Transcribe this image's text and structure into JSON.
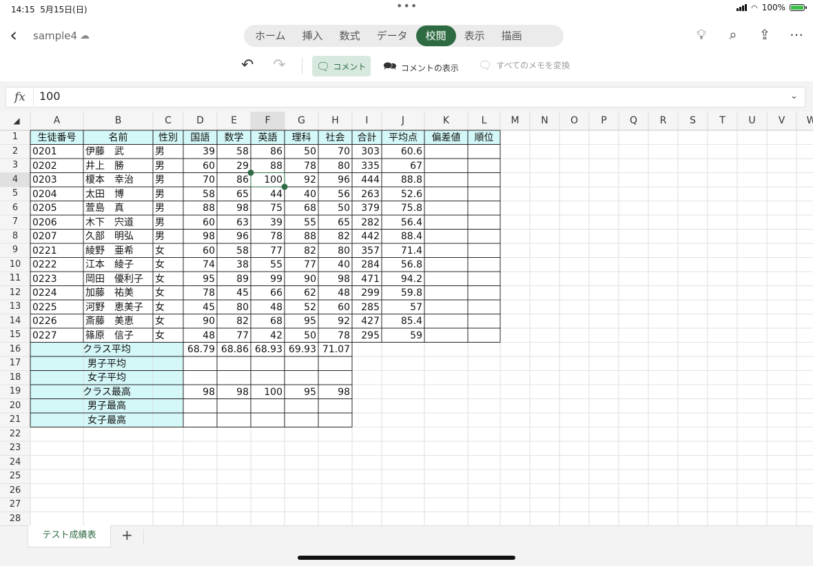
{
  "status": {
    "time": "14:15",
    "date": "5月15日(日)",
    "battery": "100%"
  },
  "app": {
    "filename": "sample4"
  },
  "tabs": [
    {
      "label": "ホーム",
      "active": false
    },
    {
      "label": "挿入",
      "active": false
    },
    {
      "label": "数式",
      "active": false
    },
    {
      "label": "データ",
      "active": false
    },
    {
      "label": "校閲",
      "active": true
    },
    {
      "label": "表示",
      "active": false
    },
    {
      "label": "描画",
      "active": false
    }
  ],
  "ribbon": {
    "comment": "コメント",
    "show_comments": "コメントの表示",
    "convert_notes": "すべてのメモを変換"
  },
  "formula": {
    "fx": "fx",
    "value": "100"
  },
  "columns": [
    "A",
    "B",
    "C",
    "D",
    "E",
    "F",
    "G",
    "H",
    "I",
    "J",
    "K",
    "L",
    "M",
    "N",
    "O",
    "P",
    "Q",
    "R",
    "S",
    "T",
    "U",
    "V",
    "W"
  ],
  "rows": [
    "1",
    "2",
    "3",
    "4",
    "5",
    "6",
    "7",
    "8",
    "9",
    "10",
    "11",
    "12",
    "13",
    "14",
    "15",
    "16",
    "17",
    "18",
    "19",
    "20",
    "21",
    "22",
    "23",
    "24",
    "25",
    "26",
    "27",
    "28"
  ],
  "selected": {
    "col": "F",
    "row": "4"
  },
  "header_row": [
    "生徒番号",
    "名前",
    "性別",
    "国語",
    "数学",
    "英語",
    "理科",
    "社会",
    "合計",
    "平均点",
    "偏差値",
    "順位"
  ],
  "students": [
    [
      "0201",
      "伊藤　武",
      "男",
      "39",
      "58",
      "86",
      "50",
      "70",
      "303",
      "60.6"
    ],
    [
      "0202",
      "井上　勝",
      "男",
      "60",
      "29",
      "88",
      "78",
      "80",
      "335",
      "67"
    ],
    [
      "0203",
      "榎本　幸治",
      "男",
      "70",
      "86",
      "100",
      "92",
      "96",
      "444",
      "88.8"
    ],
    [
      "0204",
      "太田　博",
      "男",
      "58",
      "65",
      "44",
      "40",
      "56",
      "263",
      "52.6"
    ],
    [
      "0205",
      "萱島　真",
      "男",
      "88",
      "98",
      "75",
      "68",
      "50",
      "379",
      "75.8"
    ],
    [
      "0206",
      "木下　宍道",
      "男",
      "60",
      "63",
      "39",
      "55",
      "65",
      "282",
      "56.4"
    ],
    [
      "0207",
      "久部　明弘",
      "男",
      "98",
      "96",
      "78",
      "88",
      "82",
      "442",
      "88.4"
    ],
    [
      "0221",
      "綾野　亜希",
      "女",
      "60",
      "58",
      "77",
      "82",
      "80",
      "357",
      "71.4"
    ],
    [
      "0222",
      "江本　綾子",
      "女",
      "74",
      "38",
      "55",
      "77",
      "40",
      "284",
      "56.8"
    ],
    [
      "0223",
      "岡田　優利子",
      "女",
      "95",
      "89",
      "99",
      "90",
      "98",
      "471",
      "94.2"
    ],
    [
      "0224",
      "加藤　祐美",
      "女",
      "78",
      "45",
      "66",
      "62",
      "48",
      "299",
      "59.8"
    ],
    [
      "0225",
      "河野　恵美子",
      "女",
      "45",
      "80",
      "48",
      "52",
      "60",
      "285",
      "57"
    ],
    [
      "0226",
      "斎藤　美恵",
      "女",
      "90",
      "82",
      "68",
      "95",
      "92",
      "427",
      "85.4"
    ],
    [
      "0227",
      "篠原　信子",
      "女",
      "48",
      "77",
      "42",
      "50",
      "78",
      "295",
      "59"
    ]
  ],
  "summary": [
    {
      "label": "クラス平均",
      "values": [
        "68.79",
        "68.86",
        "68.93",
        "69.93",
        "71.07"
      ]
    },
    {
      "label": "男子平均",
      "values": [
        "",
        "",
        "",
        "",
        ""
      ]
    },
    {
      "label": "女子平均",
      "values": [
        "",
        "",
        "",
        "",
        ""
      ]
    },
    {
      "label": "クラス最高",
      "values": [
        "98",
        "98",
        "100",
        "95",
        "98"
      ]
    },
    {
      "label": "男子最高",
      "values": [
        "",
        "",
        "",
        "",
        ""
      ]
    },
    {
      "label": "女子最高",
      "values": [
        "",
        "",
        "",
        "",
        ""
      ]
    }
  ],
  "sheet": {
    "tab": "テスト成績表",
    "add": "+"
  },
  "colors": {
    "accent": "#2e6b42",
    "header_fill": "#d4f7f7",
    "selected_header": "#e0e0e0"
  }
}
